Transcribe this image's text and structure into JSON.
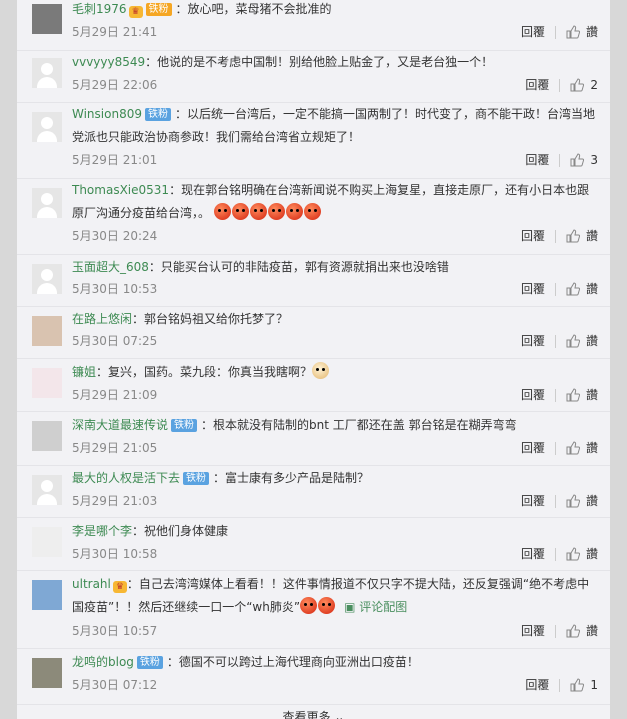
{
  "labels": {
    "reply": "回覆",
    "like_placeholder": "讚",
    "more": "查看更多"
  },
  "comments": [
    {
      "user": "毛刺1976",
      "badge": "铁粉",
      "badge_color": "#f5a623",
      "text": "：放心吧，菜母猪不会批准的",
      "time": "5月29日 21:41",
      "likes": "讚"
    },
    {
      "user": "vvvyyy8549",
      "text": "：他说的是不考虑中国制！别给他脸上贴金了，又是老台独一个！",
      "time": "5月29日 22:06",
      "likes": "2"
    },
    {
      "user": "Winsion809",
      "badge": "铁粉",
      "badge_color": "#5aa2e0",
      "text": "：以后统一台湾后，一定不能搞一国两制了！时代变了，商不能干政！台湾当地党派也只能政治协商参政！我们需给台湾省立规矩了！",
      "time": "5月29日 21:01",
      "likes": "3"
    },
    {
      "user": "ThomasXie0531",
      "text": "：现在郭台铭明确在台湾新闻说不购买上海复星，直接走原厂，还有小日本也跟原厂沟通分疫苗给台湾，。",
      "time": "5月30日 20:24",
      "likes": "讚"
    },
    {
      "user": "玉面超大_608",
      "text": "：只能买台认可的非陆疫苗，郭有资源就捐出来也没啥错",
      "time": "5月30日 10:53",
      "likes": "讚"
    },
    {
      "user": "在路上悠闲",
      "text": "：郭台铭妈祖又给你托梦了？",
      "time": "5月30日 07:25",
      "likes": "讚"
    },
    {
      "user": "镰姐",
      "text": "：复兴，国药。菜九段：你真当我瞎啊？",
      "time": "5月29日 21:09",
      "likes": "讚"
    },
    {
      "user": "深南大道最速传说",
      "badge": "铁粉",
      "badge_color": "#5aa2e0",
      "text": "：根本就没有陆制的bnt 工厂都还在盖  郭台铭是在糊弄弯弯",
      "time": "5月29日 21:05",
      "likes": "讚"
    },
    {
      "user": "最大的人权是活下去",
      "badge": "铁粉",
      "badge_color": "#5aa2e0",
      "text": "：富士康有多少产品是陆制？",
      "time": "5月29日 21:03",
      "likes": "讚"
    },
    {
      "user": "李是哪个李",
      "text": "：祝他们身体健康",
      "time": "5月30日 10:58",
      "likes": "讚"
    },
    {
      "user": "ultrahl",
      "text": "：自己去湾湾媒体上看看！！这件事情报道不仅只字不提大陆，还反复强调“绝不考虑中国疫苗”！！然后还继续一口一个“wh肺炎”",
      "time": "5月30日 10:57",
      "likes": "讚",
      "image_link": "评论配图"
    },
    {
      "user": "龙鸣的blog",
      "badge": "铁粉",
      "badge_color": "#5aa2e0",
      "text": "：德国不可以跨过上海代理商向亚洲出口疫苗！",
      "time": "5月30日 07:12",
      "likes": "1"
    }
  ]
}
